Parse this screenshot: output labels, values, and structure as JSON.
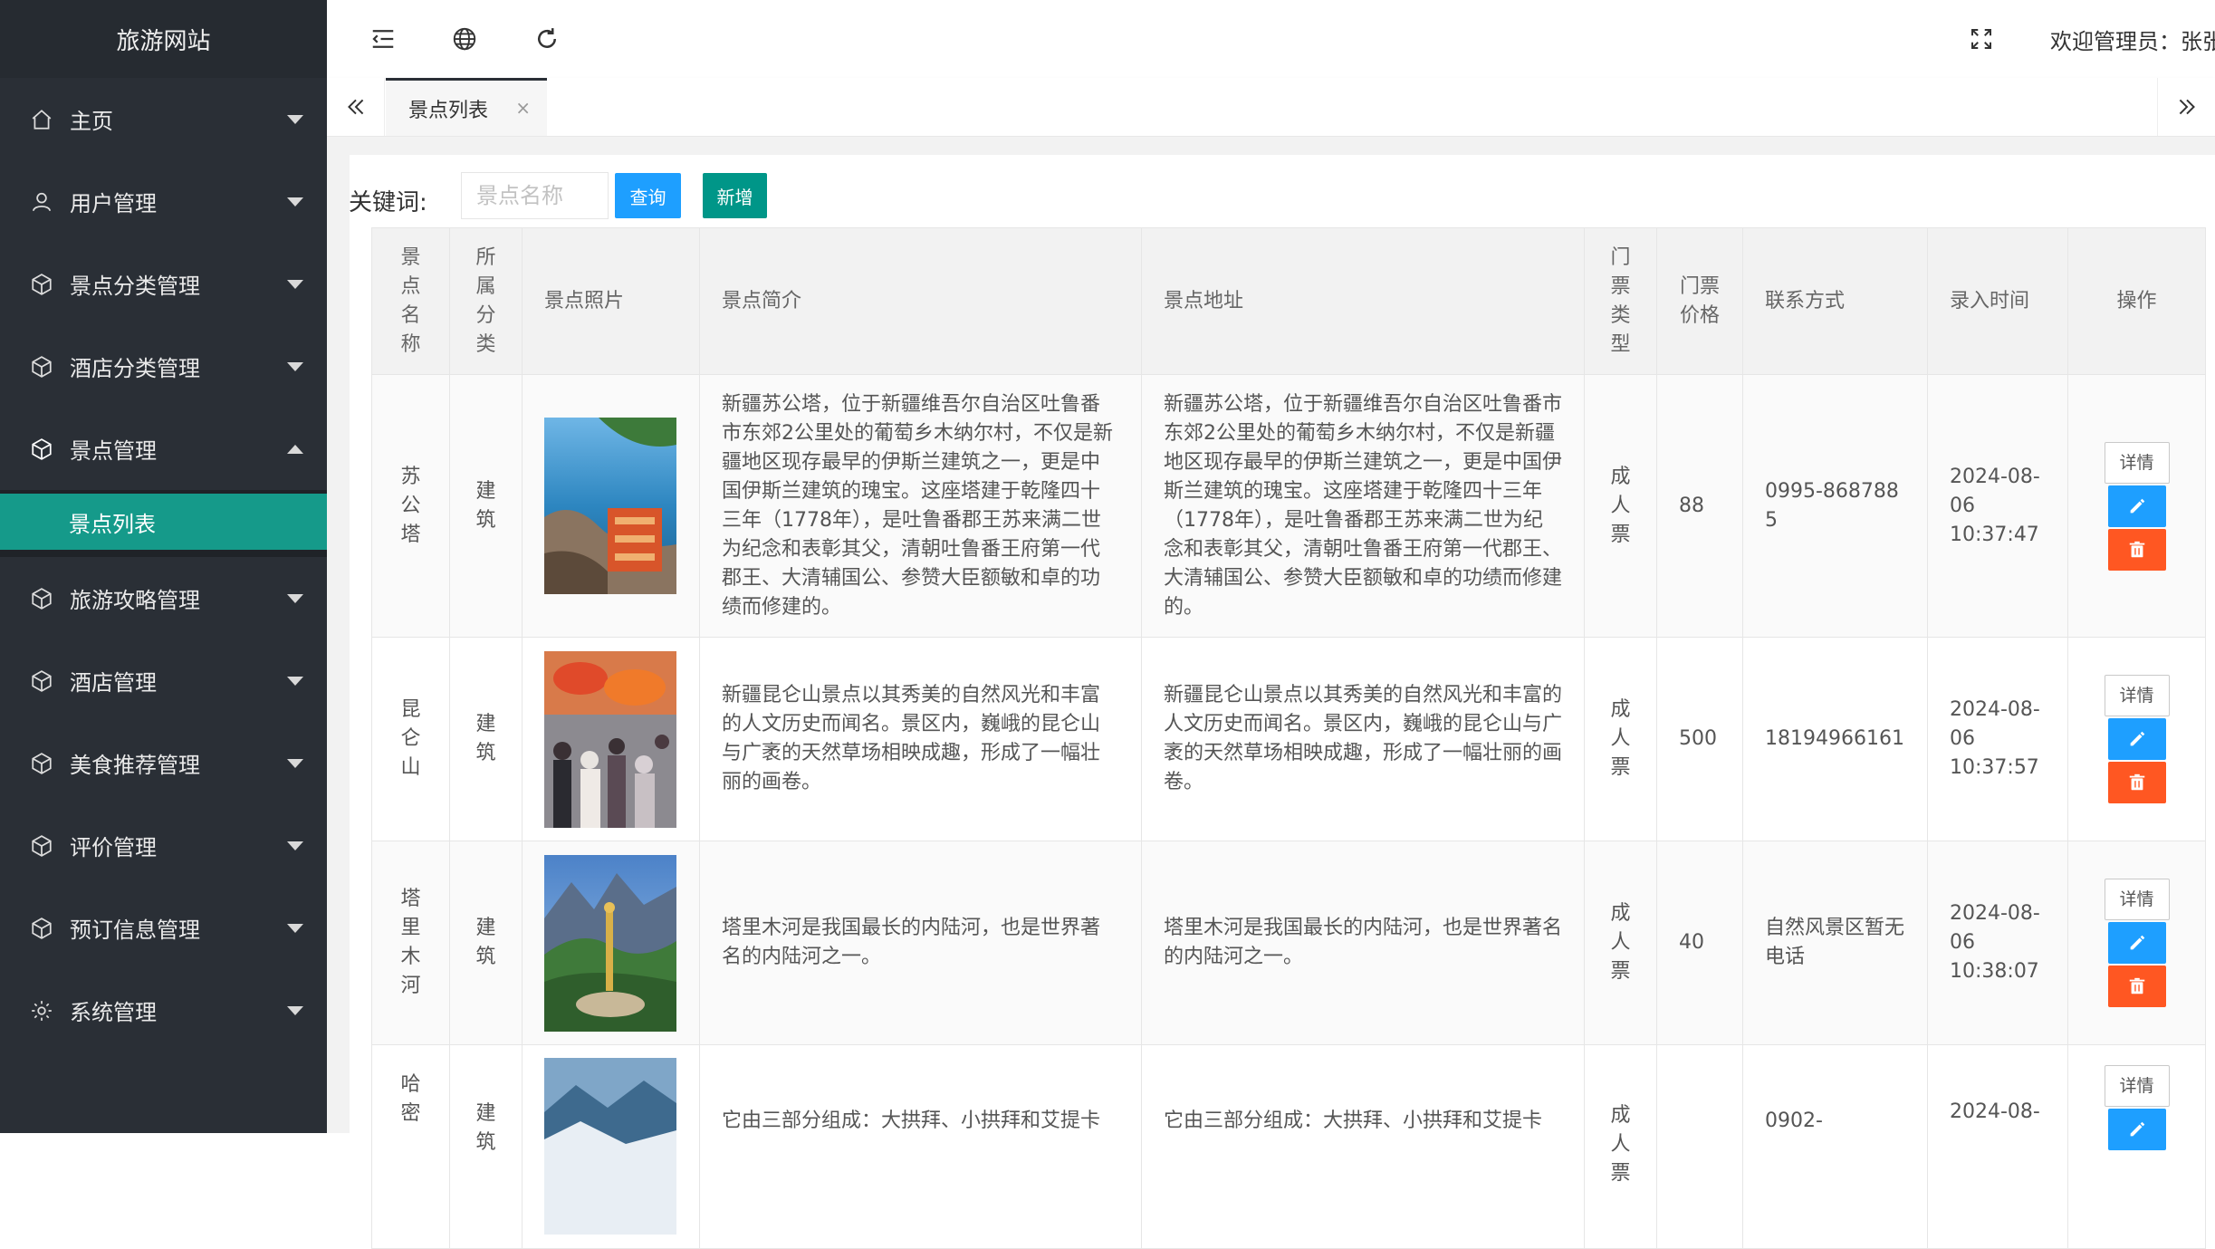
{
  "app": {
    "title": "旅游网站"
  },
  "sidebar": {
    "items": [
      {
        "label": "主页",
        "icon": "home-icon"
      },
      {
        "label": "用户管理",
        "icon": "user-icon"
      },
      {
        "label": "景点分类管理",
        "icon": "cube-icon"
      },
      {
        "label": "酒店分类管理",
        "icon": "cube-icon"
      },
      {
        "label": "景点管理",
        "icon": "cube-icon",
        "expanded": true
      },
      {
        "label": "旅游攻略管理",
        "icon": "cube-icon"
      },
      {
        "label": "酒店管理",
        "icon": "cube-icon"
      },
      {
        "label": "美食推荐管理",
        "icon": "cube-icon"
      },
      {
        "label": "评价管理",
        "icon": "cube-icon"
      },
      {
        "label": "预订信息管理",
        "icon": "cube-icon"
      },
      {
        "label": "系统管理",
        "icon": "gear-icon"
      }
    ],
    "submenu": {
      "label": "景点列表"
    }
  },
  "header": {
    "welcome": "欢迎管理员：张张"
  },
  "tabs": {
    "active": "景点列表",
    "close": "×"
  },
  "search": {
    "label": "关键词:",
    "placeholder": "景点名称",
    "query_label": "查询",
    "add_label": "新增"
  },
  "table": {
    "columns": [
      "景点名称",
      "所属分类",
      "景点照片",
      "景点简介",
      "景点地址",
      "门票类型",
      "门票价格",
      "联系方式",
      "录入时间",
      "操作"
    ],
    "rows": [
      {
        "name": "苏公塔",
        "category": "建筑",
        "intro": "新疆苏公塔，位于新疆维吾尔自治区吐鲁番市东郊2公里处的葡萄乡木纳尔村，不仅是新疆地区现存最早的伊斯兰建筑之一，更是中国伊斯兰建筑的瑰宝。这座塔建于乾隆四十三年（1778年），是吐鲁番郡王苏来满二世为纪念和表彰其父，清朝吐鲁番王府第一代郡王、大清辅国公、参赞大臣额敏和卓的功绩而修建的。",
        "address": "新疆苏公塔，位于新疆维吾尔自治区吐鲁番市东郊2公里处的葡萄乡木纳尔村，不仅是新疆地区现存最早的伊斯兰建筑之一，更是中国伊斯兰建筑的瑰宝。这座塔建于乾隆四十三年（1778年），是吐鲁番郡王苏来满二世为纪念和表彰其父，清朝吐鲁番王府第一代郡王、大清辅国公、参赞大臣额敏和卓的功绩而修建的。",
        "ticket_type": "成人票",
        "price": "88",
        "contact": "0995-8687885",
        "time": "2024-08-06 10:37:47",
        "detail": "详情"
      },
      {
        "name": "昆仑山",
        "category": "建筑",
        "intro": "新疆昆仑山景点以其秀美的自然风光和丰富的人文历史而闻名。景区内，巍峨的昆仑山与广袤的天然草场相映成趣，形成了一幅壮丽的画卷。",
        "address": "新疆昆仑山景点以其秀美的自然风光和丰富的人文历史而闻名。景区内，巍峨的昆仑山与广袤的天然草场相映成趣，形成了一幅壮丽的画卷。",
        "ticket_type": "成人票",
        "price": "500",
        "contact": "18194966161",
        "time": "2024-08-06 10:37:57",
        "detail": "详情"
      },
      {
        "name": "塔里木河",
        "category": "建筑",
        "intro": "塔里木河是我国最长的内陆河，也是世界著名的内陆河之一。",
        "address": "塔里木河是我国最长的内陆河，也是世界著名的内陆河之一。",
        "ticket_type": "成人票",
        "price": "40",
        "contact": "自然风景区暂无电话",
        "time": "2024-08-06 10:38:07",
        "detail": "详情"
      },
      {
        "name": "哈密",
        "category": "建筑",
        "intro": "它由三部分组成：大拱拜、小拱拜和艾提卡",
        "address": "它由三部分组成：大拱拜、小拱拜和艾提卡",
        "ticket_type": "成人票",
        "price": "",
        "contact": "0902-",
        "time": "2024-08-",
        "detail": "详情"
      }
    ]
  },
  "colors": {
    "sidebar_bg": "#2a2f36",
    "active_teal": "#159a8a",
    "blue": "#1e9fff",
    "green": "#009688",
    "red": "#ff5722"
  }
}
